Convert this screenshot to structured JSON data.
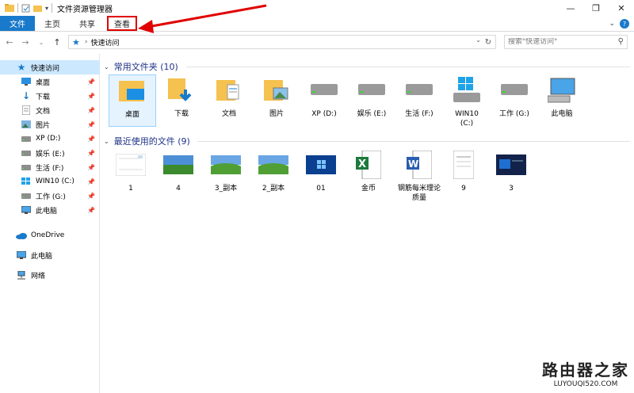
{
  "window": {
    "title": "文件资源管理器"
  },
  "ribbon": {
    "tabs": [
      "文件",
      "主页",
      "共享",
      "查看"
    ]
  },
  "address": {
    "crumb": "快速访问",
    "search_placeholder": "搜索\"快速访问\""
  },
  "nav": {
    "items": [
      {
        "label": "快速访问",
        "icon": "star-icon",
        "pinned": false
      },
      {
        "label": "桌面",
        "icon": "desktop-icon",
        "pinned": true
      },
      {
        "label": "下载",
        "icon": "download-icon",
        "pinned": true
      },
      {
        "label": "文档",
        "icon": "document-icon",
        "pinned": true
      },
      {
        "label": "图片",
        "icon": "pictures-icon",
        "pinned": true
      },
      {
        "label": "XP (D:)",
        "icon": "drive-icon",
        "pinned": true
      },
      {
        "label": "娱乐 (E:)",
        "icon": "drive-icon",
        "pinned": true
      },
      {
        "label": "生活 (F:)",
        "icon": "drive-icon",
        "pinned": true
      },
      {
        "label": "WIN10 (C:)",
        "icon": "windows-drive-icon",
        "pinned": true
      },
      {
        "label": "工作 (G:)",
        "icon": "drive-icon",
        "pinned": true
      },
      {
        "label": "此电脑",
        "icon": "computer-icon",
        "pinned": true
      },
      {
        "label": "OneDrive",
        "icon": "onedrive-icon",
        "pinned": false
      },
      {
        "label": "此电脑",
        "icon": "computer-icon",
        "pinned": false
      },
      {
        "label": "网络",
        "icon": "network-icon",
        "pinned": false
      }
    ]
  },
  "frequent": {
    "heading": "常用文件夹 (10)",
    "items": [
      {
        "label": "桌面",
        "icon": "desktop-folder-icon"
      },
      {
        "label": "下载",
        "icon": "download-folder-icon"
      },
      {
        "label": "文档",
        "icon": "document-folder-icon"
      },
      {
        "label": "图片",
        "icon": "pictures-folder-icon"
      },
      {
        "label": "XP (D:)",
        "icon": "drive-icon"
      },
      {
        "label": "娱乐 (E:)",
        "icon": "drive-icon"
      },
      {
        "label": "生活 (F:)",
        "icon": "drive-icon"
      },
      {
        "label": "WIN10 (C:)",
        "icon": "windows-drive-icon"
      },
      {
        "label": "工作 (G:)",
        "icon": "drive-icon"
      },
      {
        "label": "此电脑",
        "icon": "computer-icon"
      }
    ]
  },
  "recent": {
    "heading": "最近使用的文件 (9)",
    "items": [
      {
        "label": "1",
        "icon": "document-thumbnail-icon"
      },
      {
        "label": "4",
        "icon": "landscape-thumbnail-icon"
      },
      {
        "label": "3_副本",
        "icon": "landscape-thumbnail-icon"
      },
      {
        "label": "2_副本",
        "icon": "landscape-thumbnail-icon"
      },
      {
        "label": "01",
        "icon": "win-desktop-thumbnail-icon"
      },
      {
        "label": "金币",
        "icon": "excel-icon"
      },
      {
        "label": "钢筋每米理论质量",
        "icon": "word-icon"
      },
      {
        "label": "9",
        "icon": "document-thumbnail-icon"
      },
      {
        "label": "3",
        "icon": "blue-screen-thumbnail-icon"
      }
    ]
  },
  "watermark": {
    "line1": "路由器之家",
    "line2": "LUYOUQI520.COM"
  },
  "colors": {
    "accent": "#1979ca",
    "highlight": "#e00000",
    "heading": "#1e3287"
  }
}
